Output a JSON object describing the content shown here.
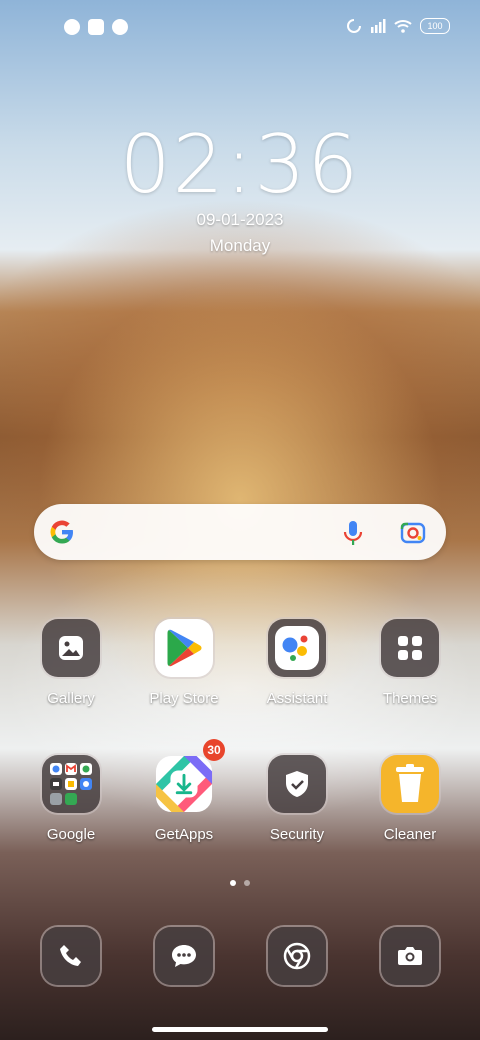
{
  "status_bar": {
    "battery_level": "100",
    "left_icons": [
      "notification-icon-1",
      "notification-icon-2",
      "notification-icon-3"
    ],
    "right_icons": [
      "sync-icon",
      "signal-icon",
      "wifi-icon",
      "battery-icon"
    ]
  },
  "lockclock": {
    "time": "02:36",
    "date": "09-01-2023",
    "day": "Monday"
  },
  "search_bar": {
    "icons": [
      "google-logo-icon",
      "microphone-icon",
      "google-lens-icon"
    ]
  },
  "apps": {
    "row1": [
      {
        "label": "Gallery",
        "icon": "gallery-icon"
      },
      {
        "label": "Play Store",
        "icon": "play-store-icon"
      },
      {
        "label": "Assistant",
        "icon": "assistant-icon"
      },
      {
        "label": "Themes",
        "icon": "themes-icon"
      }
    ],
    "row2": [
      {
        "label": "Google",
        "icon": "folder-icon"
      },
      {
        "label": "GetApps",
        "icon": "getapps-icon",
        "badge": "30"
      },
      {
        "label": "Security",
        "icon": "security-icon"
      },
      {
        "label": "Cleaner",
        "icon": "cleaner-icon"
      }
    ]
  },
  "dock": [
    {
      "icon": "phone-icon"
    },
    {
      "icon": "messages-icon"
    },
    {
      "icon": "chrome-icon"
    },
    {
      "icon": "camera-icon"
    }
  ],
  "page_indicator": {
    "pages": 2,
    "current": 1
  },
  "colors": {
    "badge": "#e8452c",
    "tile": "#463e40",
    "cleaner": "#f5b52b",
    "play_green": "#2ba84a",
    "play_blue": "#4285f4",
    "play_yellow": "#fbbc04",
    "play_red": "#ea4335"
  }
}
